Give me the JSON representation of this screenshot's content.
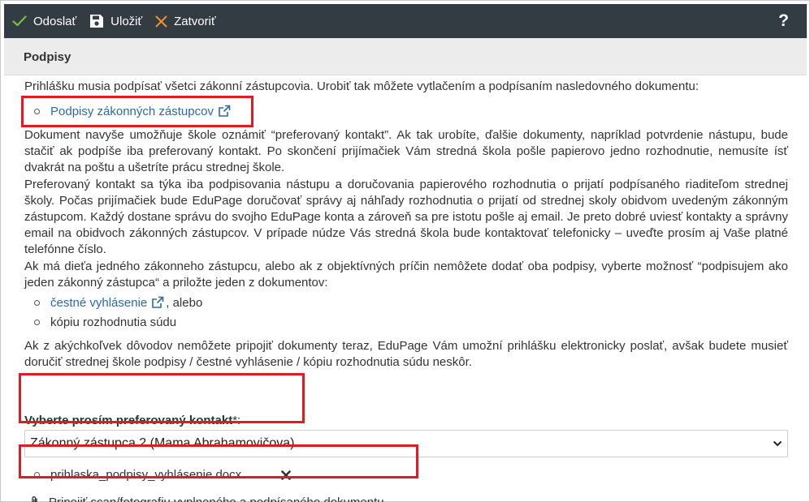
{
  "toolbar": {
    "send_label": "Odoslať",
    "save_label": "Uložiť",
    "close_label": "Zatvoriť",
    "help_label": "?"
  },
  "section": {
    "title": "Podpisy"
  },
  "content": {
    "intro": "Prihlášku musia podpísať všetci zákonní zástupcovia. Urobiť tak môžete vytlačením a podpísaním nasledovného dokumentu:",
    "doc_link": "Podpisy zákonných zástupcov",
    "para1": "Dokument navyše umožňuje škole oznámiť “preferovaný kontakt”. Ak tak urobíte, ďalšie dokumenty, napríklad potvrdenie nástupu, bude stačiť ak podpíše iba preferovaný kontakt. Po skončení prijímačiek Vám stredná škola pošle papierovo jedno rozhodnutie, nemusíte ísť dvakrát na poštu a ušetríte prácu strednej škole.",
    "para2": "Preferovaný kontakt sa týka iba podpisovania nástupu a doručovania papierového rozhodnutia o prijatí podpísaného riaditeľom strednej školy. Počas prijímačiek bude EduPage doručovať správy aj náhľady rozhodnutia o prijatí od strednej skoly obidvom uvedeným zákonným zástupcom. Každý dostane správu do svojho EduPage konta a zároveň sa pre istotu pošle aj email. Je preto dobré uviesť kontakty a správny email na obidvoch zákonných zástupcov. V prípade núdze Vás stredná škola bude kontaktovať telefonicky – uveďte prosím aj Vaše platné telefónne číslo.",
    "para3": "Ak má dieťa jedného zákonneho zástupcu, alebo ak z objektívných príčin nemôžete dodať oba podpisy, vyberte možnosť “podpisujem ako jeden zákonný zástupca“ a priložte jeden z dokumentov:",
    "option1_link": "čestné vyhlásenie",
    "option1_suffix": ", alebo",
    "option2": "kópiu rozhodnutia súdu",
    "para4": "Ak z akýchkoľvek dôvodov nemôžete pripojiť dokumenty teraz, EduPage Vám umožní prihlášku elektronicky poslať, avšak budete musieť doručiť strednej škole podpisy / čestné vyhlásenie / kópiu rozhodnutia súdu neskôr."
  },
  "form": {
    "contact_label": "Vyberte prosím preferovaný kontakt",
    "required_mark": "*:",
    "contact_value": "Zákonný zástupca 2 (Mama Abrahamovičova)",
    "file_name": "prihlaska_podpisy_vyhlásenie.docx",
    "attach_label": "Pripojiť scan/fotografiu vyplneného a podpísaného dokumentu"
  },
  "colors": {
    "toolbar_bg": "#333b43",
    "highlight": "#e21b23",
    "link": "#2a6aa8",
    "check": "#7bc043",
    "close": "#f0932b"
  }
}
